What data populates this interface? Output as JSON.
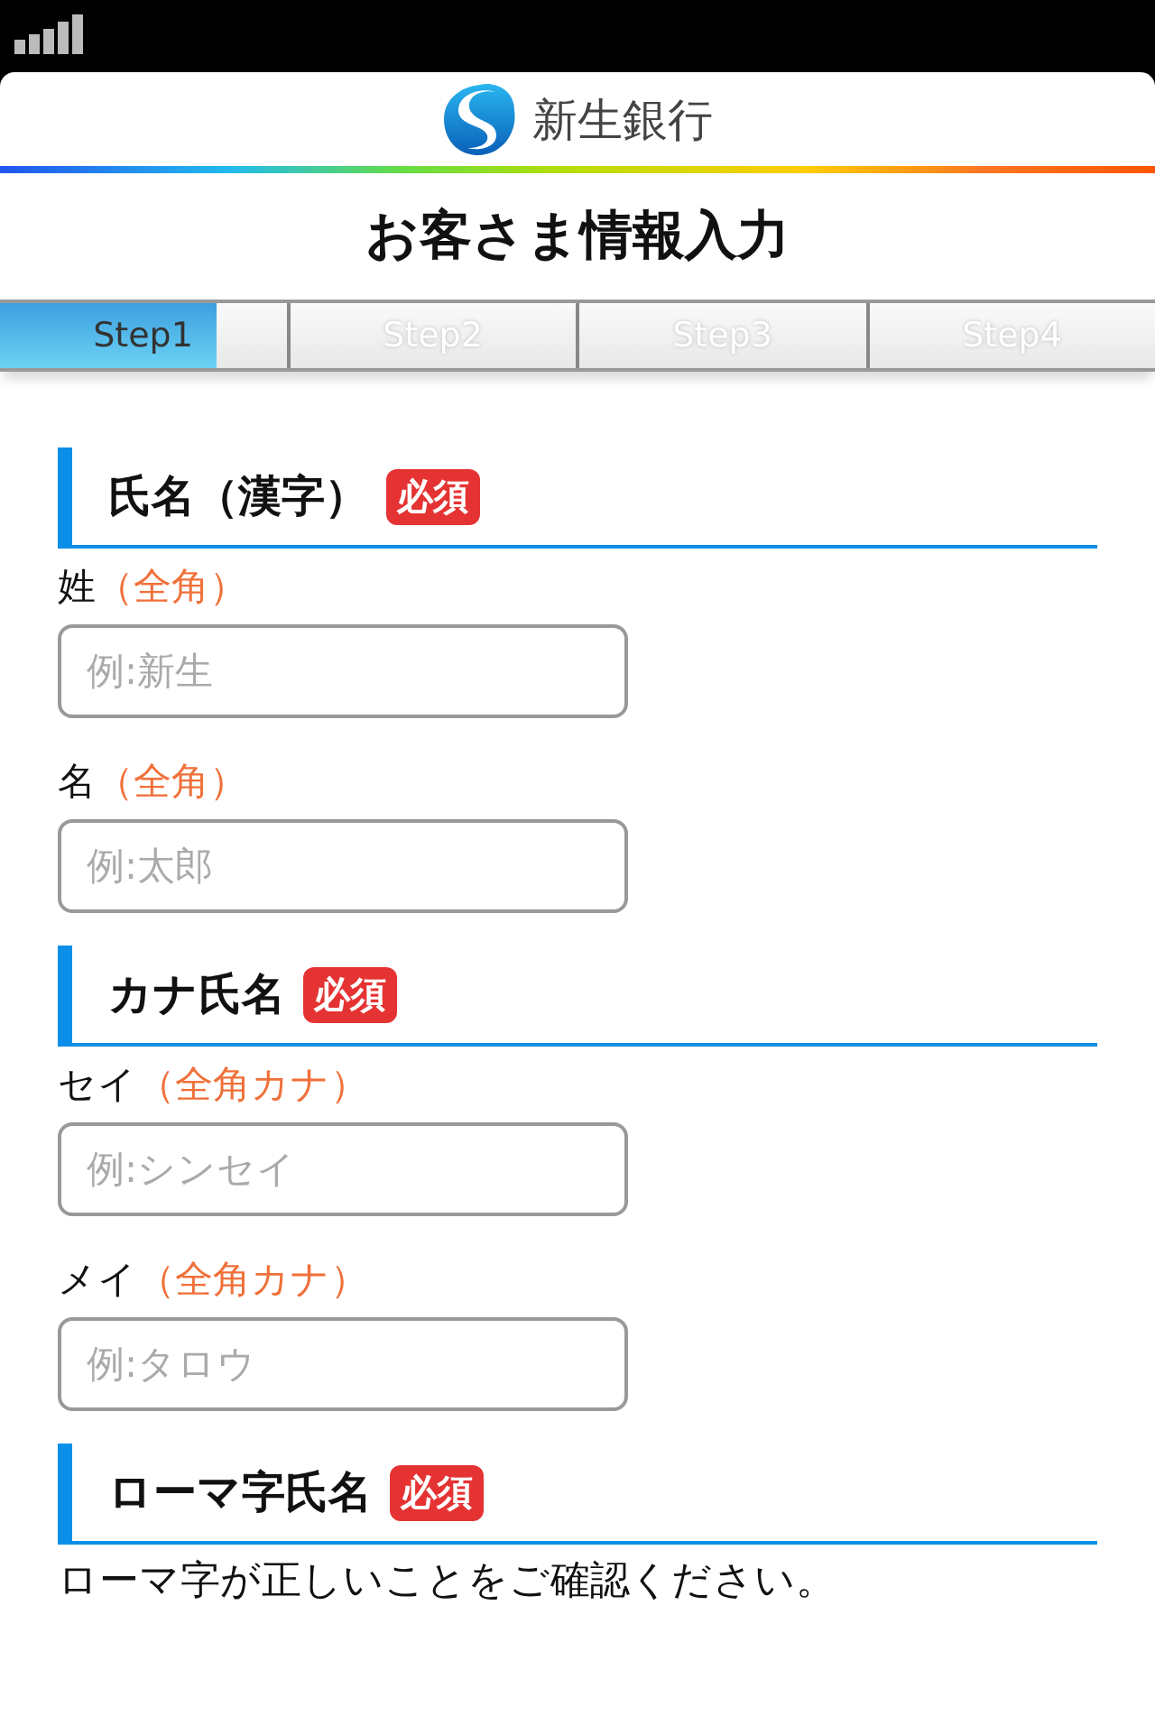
{
  "header": {
    "logo_text": "新生銀行"
  },
  "title": "お客さま情報入力",
  "progress": {
    "level": 0.1875
  },
  "steps": [
    {
      "label": "Step1",
      "selected": true
    },
    {
      "label": "Step2",
      "selected": false
    },
    {
      "label": "Step3",
      "selected": false
    },
    {
      "label": "Step4",
      "selected": false
    }
  ],
  "sections": [
    {
      "heading": "氏名（漢字）",
      "badge": "必須",
      "fields": [
        {
          "label": "姓",
          "note": "（全角）",
          "placeholder": "例:新生"
        },
        {
          "label": "名",
          "note": "（全角）",
          "placeholder": "例:太郎"
        }
      ]
    },
    {
      "heading": "カナ氏名",
      "badge": "必須",
      "fields": [
        {
          "label": "セイ",
          "note": "（全角カナ）",
          "placeholder": "例:シンセイ"
        },
        {
          "label": "メイ",
          "note": "（全角カナ）",
          "placeholder": "例:タロウ"
        }
      ]
    },
    {
      "heading": "ローマ字氏名",
      "badge": "必須",
      "description": "ローマ字が正しいことをご確認ください。"
    }
  ]
}
